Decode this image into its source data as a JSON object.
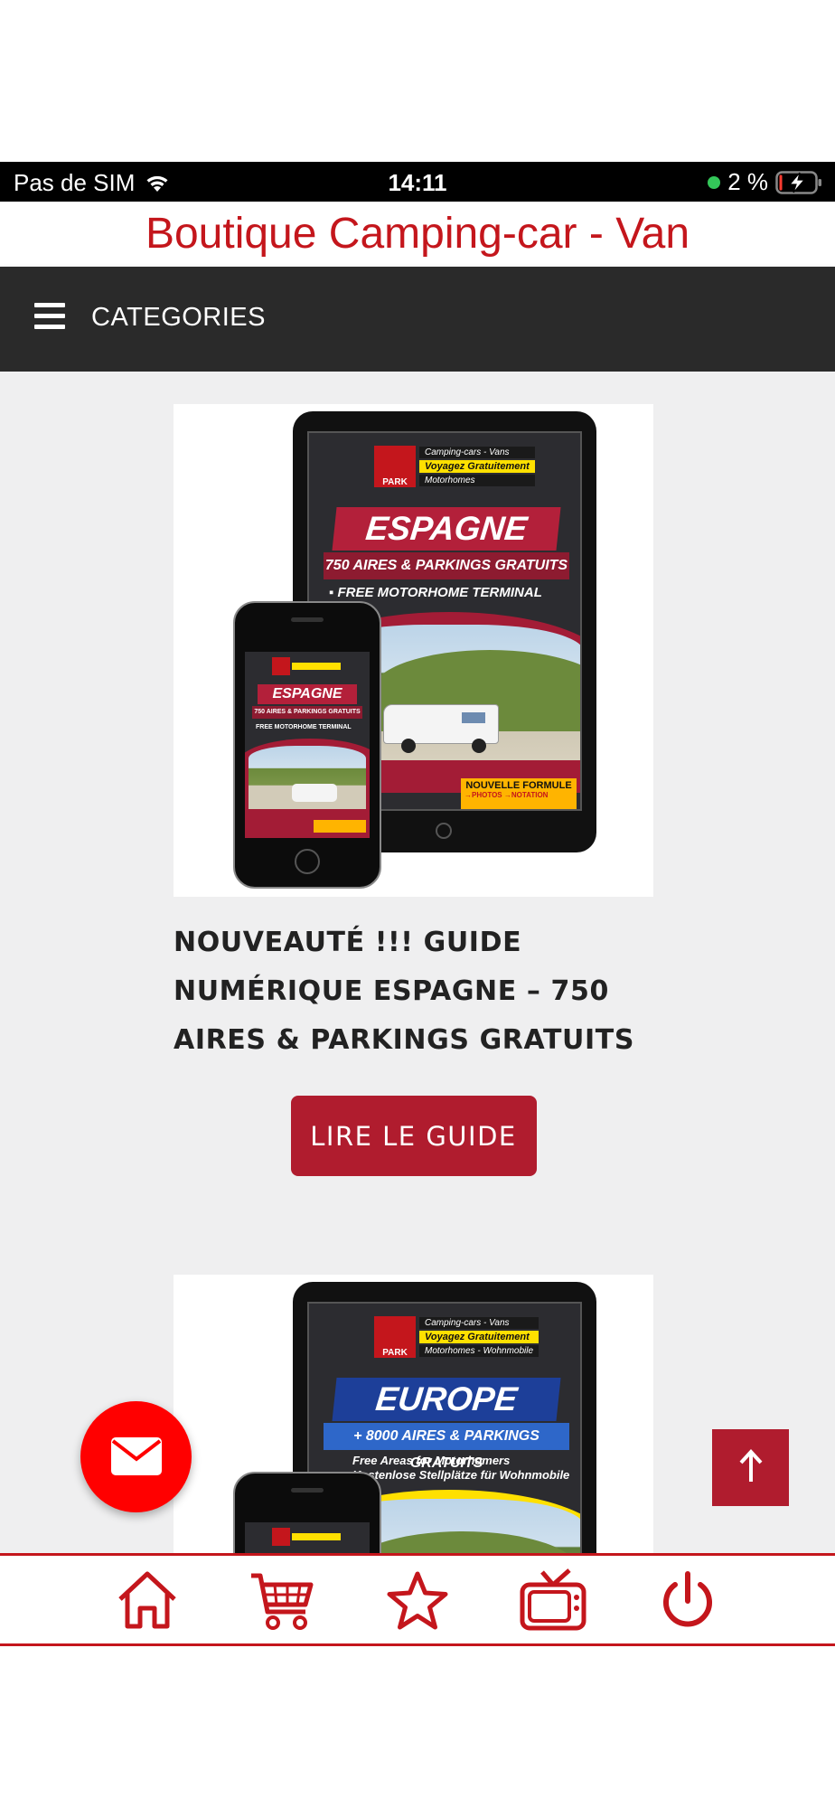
{
  "status_bar": {
    "carrier": "Pas de SIM",
    "time": "14:11",
    "battery": "2 %"
  },
  "header": {
    "store_title": "Boutique Camping-car - Van"
  },
  "nav": {
    "menu_label": "CATEGORIES"
  },
  "products": [
    {
      "title": "NOUVEAUTÉ !!! GUIDE NUMÉRIQUE ESPAGNE – 750 AIRES & PARKINGS GRATUITS",
      "button_label": "LIRE LE GUIDE",
      "cover": {
        "tag_top": "Camping-cars - Vans",
        "tag_mid": "Voyagez Gratuitement",
        "tag_bot": "Motorhomes",
        "country": "ESPAGNE",
        "aires": "750 AIRES & PARKINGS GRATUITS",
        "subtitle": "FREE MOTORHOME TERMINAL",
        "formule": "NOUVELLE FORMULE",
        "formule_sub": "→PHOTOS →NOTATION"
      }
    },
    {
      "cover": {
        "tag_top": "Camping-cars - Vans",
        "tag_mid": "Voyagez Gratuitement",
        "tag_bot": "Motorhomes - Wohnmobile",
        "country": "EUROPE",
        "aires": "+ 8000 AIRES & PARKINGS GRATUITS",
        "subtitle": "Free Areas for Motorhomers",
        "subtitle2": "Kostenlose Stellplätze für Wohnmobile"
      }
    }
  ],
  "colors": {
    "brand_red": "#c4161c",
    "button_red": "#b01c2e",
    "nav_dark": "#2a2a2a",
    "fab_red": "#ff0000",
    "content_bg": "#efeff0"
  },
  "bottom_nav": {
    "icons": [
      "home-icon",
      "cart-icon",
      "star-icon",
      "tv-icon",
      "power-icon"
    ]
  }
}
